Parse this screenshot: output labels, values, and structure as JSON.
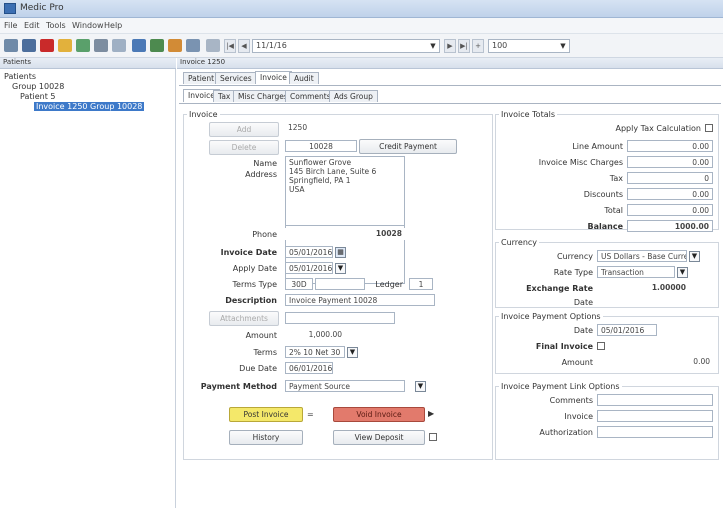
{
  "window": {
    "title": "Medic Pro"
  },
  "menubar": {
    "items": [
      "File",
      "Edit",
      "Tools",
      "Window",
      "Help"
    ]
  },
  "toolbar": {
    "date_combo": "11/1/16",
    "view_combo": "100"
  },
  "left_pane": {
    "header": "Patients",
    "tree": [
      "Patients",
      "Group 10028",
      "Patient 5",
      "Invoice 1250 Group 10028"
    ]
  },
  "right_pane": {
    "header": "Invoice 1250",
    "top_tabs": [
      "Patient",
      "Services",
      "Invoice",
      "Audit"
    ],
    "sub_tabs": [
      "Invoice",
      "Tax",
      "Misc Charges",
      "Comments",
      "Ads Group"
    ],
    "left": {
      "group_label": "Invoice",
      "add_button": "Add",
      "delete_button": "Delete",
      "invoice_no": "1250",
      "id_field": "10028",
      "ref_button": "Credit Payment",
      "name_label": "Name",
      "address_label": "Address",
      "address_lines": [
        "Sunflower Grove",
        "145 Birch Lane, Suite 6",
        "Springfield, PA 1",
        "USA"
      ],
      "phone_label": "Phone",
      "phone_value": "10028",
      "invoice_date_label": "Invoice Date",
      "invoice_date": "05/01/2016",
      "apply_date_label": "Apply Date",
      "apply_date": "05/01/2016",
      "terms_label": "Terms Type",
      "terms_value": "30D",
      "ledger_label": "Ledger",
      "ledger_value": "1",
      "description_label": "Description",
      "description": "Invoice Payment 10028",
      "attach_button": "Attachments",
      "amount_label": "Amount",
      "amount": "1,000.00",
      "terms2_label": "Terms",
      "terms2": "2% 10 Net 30",
      "due_date_label": "Due Date",
      "due_date": "06/01/2016",
      "payment_method_label": "Payment Method",
      "payment_method": "Payment Source",
      "post_button": "Post Invoice",
      "void_button": "Void Invoice",
      "history_button": "History",
      "view_deposit_button": "View Deposit"
    },
    "right": {
      "totals_label": "Invoice Totals",
      "apply_tax_label": "Apply Tax Calculation",
      "rows": [
        {
          "label": "Line Amount",
          "value": "0.00"
        },
        {
          "label": "Invoice Misc Charges",
          "value": "0.00"
        },
        {
          "label": "Tax",
          "value": "0"
        },
        {
          "label": "Discounts",
          "value": "0.00"
        },
        {
          "label": "Total",
          "value": "0.00"
        },
        {
          "label": "Balance",
          "value": "1000.00"
        }
      ],
      "currency_label": "Currency",
      "currency_field_label": "Currency",
      "currency_value": "US Dollars - Base Currency",
      "rate_type_label": "Rate Type",
      "rate_type_value": "Transaction",
      "exchange_rate_label": "Exchange Rate",
      "exchange_rate": "1.00000",
      "rate_date_label": "Date",
      "payment_group_label": "Invoice Payment Options",
      "payment_date_label": "Date",
      "payment_date": "05/01/2016",
      "final_invoice_label": "Final Invoice",
      "amount_label": "Amount",
      "amount_value": "0.00",
      "extra_group_label": "Invoice Payment Link Options",
      "extra_rows": [
        "Comments",
        "Invoice",
        "Authorization"
      ]
    }
  },
  "colors": {
    "post": "#f4e86a",
    "void": "#e27a6c",
    "selected": "#3d79c9"
  }
}
